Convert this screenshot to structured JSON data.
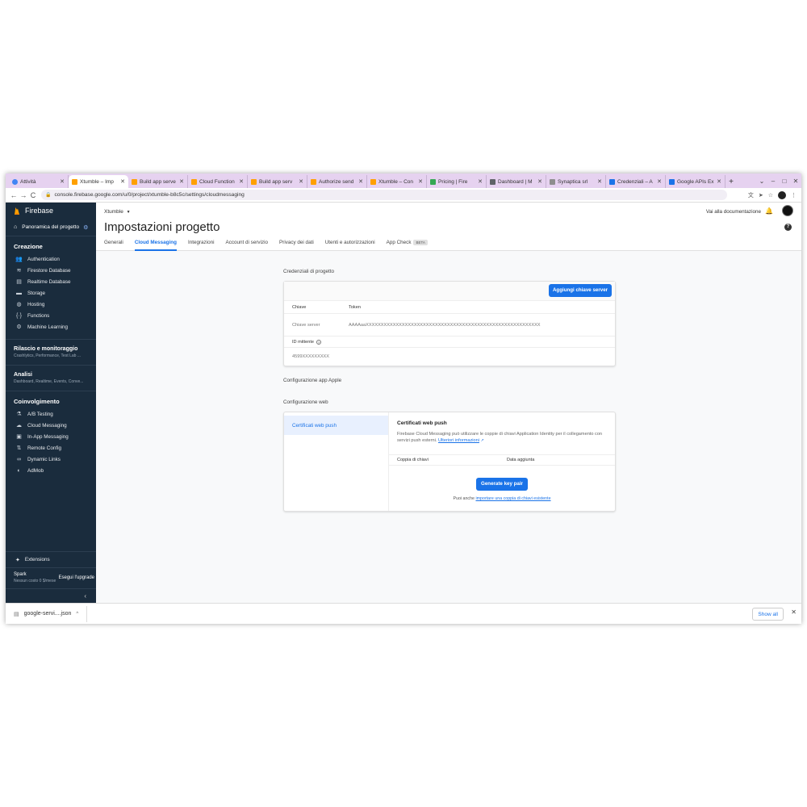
{
  "browser": {
    "tabs": [
      {
        "title": "Attività",
        "icon": "google-icon",
        "active": false
      },
      {
        "title": "Xtumble – Imp",
        "icon": "firebase-icon",
        "active": true
      },
      {
        "title": "Build app serve",
        "icon": "firebase-icon",
        "active": false
      },
      {
        "title": "Cloud Function",
        "icon": "firebase-icon",
        "active": false
      },
      {
        "title": "Build app serv",
        "icon": "firebase-icon",
        "active": false
      },
      {
        "title": "Authorize send",
        "icon": "firebase-icon",
        "active": false
      },
      {
        "title": "Xtumble – Con",
        "icon": "firebase-icon",
        "active": false
      },
      {
        "title": "Pricing | Fire",
        "icon": "pricing-icon",
        "active": false
      },
      {
        "title": "Dashboard | M",
        "icon": "dashboard-icon",
        "active": false
      },
      {
        "title": "Synaptica srl",
        "icon": "cloud-icon",
        "active": false
      },
      {
        "title": "Credenziali – A",
        "icon": "api-icon",
        "active": false
      },
      {
        "title": "Google APIs Ex",
        "icon": "api-icon",
        "active": false
      }
    ],
    "url": "console.firebase.google.com/u/0/project/xtumble-b8c5c/settings/cloudmessaging"
  },
  "sidebar": {
    "brand": "Firebase",
    "project_overview": "Panoramica del progetto",
    "section_build": "Creazione",
    "build_items": [
      {
        "label": "Authentication",
        "icon": "users-icon"
      },
      {
        "label": "Firestore Database",
        "icon": "firestore-icon"
      },
      {
        "label": "Realtime Database",
        "icon": "database-icon"
      },
      {
        "label": "Storage",
        "icon": "folder-icon"
      },
      {
        "label": "Hosting",
        "icon": "globe-icon"
      },
      {
        "label": "Functions",
        "icon": "functions-icon"
      },
      {
        "label": "Machine Learning",
        "icon": "robot-icon"
      }
    ],
    "release_title": "Rilascio e monitoraggio",
    "release_sub": "Crashlytics, Performance, Test Lab ...",
    "analytics_title": "Analisi",
    "analytics_sub": "Dashboard, Realtime, Events, Conve...",
    "section_engage": "Coinvolgimento",
    "engage_items": [
      {
        "label": "A/B Testing",
        "icon": "flask-icon"
      },
      {
        "label": "Cloud Messaging",
        "icon": "cloud-messaging-icon"
      },
      {
        "label": "In-App Messaging",
        "icon": "in-app-messaging-icon"
      },
      {
        "label": "Remote Config",
        "icon": "remote-config-icon"
      },
      {
        "label": "Dynamic Links",
        "icon": "link-icon"
      },
      {
        "label": "AdMob",
        "icon": "admob-icon"
      }
    ],
    "extensions": "Extensions",
    "plan_name": "Spark",
    "plan_sub": "Nessun costo 0 $/mese",
    "upgrade": "Esegui l'upgrade"
  },
  "header": {
    "project": "Xtumble",
    "docs_link": "Vai alla documentazione",
    "title": "Impostazioni progetto",
    "tabs": [
      {
        "label": "Generali",
        "active": false
      },
      {
        "label": "Cloud Messaging",
        "active": true
      },
      {
        "label": "Integrazioni",
        "active": false
      },
      {
        "label": "Account di servizio",
        "active": false
      },
      {
        "label": "Privacy dei dati",
        "active": false
      },
      {
        "label": "Utenti e autorizzazioni",
        "active": false
      },
      {
        "label": "App Check",
        "active": false
      }
    ],
    "beta": "BETA"
  },
  "credentials": {
    "label": "Credenziali di progetto",
    "add_button": "Aggiungi chiave server",
    "col_key": "Chiave",
    "col_token": "Token",
    "key_name": "Chiave server",
    "token_value": "AAAAaaXXXXXXXXXXXXXXXXXXXXXXXXXXXXXXXXXXXXXXXXXXXXXXXXXXXXXXXXXX",
    "sender_id_label": "ID mittente",
    "sender_id_value": "4599XXXXXXXXX"
  },
  "apple_label": "Configurazione app Apple",
  "web": {
    "label": "Configurazione web",
    "nav_item": "Certificati web push",
    "title": "Certificati web push",
    "description": "Firebase Cloud Messaging può utilizzare le coppie di chiavi Application Identity per il collegamento con servizi push esterni.",
    "learn_more": "Ulteriori informazioni",
    "col_pair": "Coppia di chiavi",
    "col_date": "Data aggiunta",
    "generate_button": "Generate key pair",
    "import_prefix": "Puoi anche",
    "import_link": "importare una coppia di chiavi esistente"
  },
  "downloads": {
    "file": "google-servi....json",
    "show_all": "Show all"
  }
}
